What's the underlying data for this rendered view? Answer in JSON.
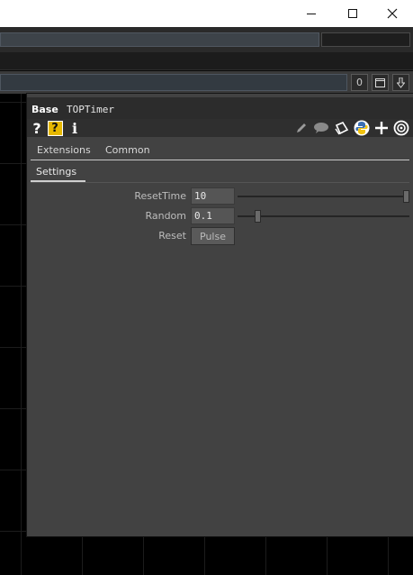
{
  "window": {
    "controls": {
      "minimize": "minimize-icon",
      "maximize": "maximize-icon",
      "close": "close-icon"
    }
  },
  "toolbar": {
    "counter_label": "0",
    "layout_icon": "window-icon",
    "pin_icon": "down-arrow-icon"
  },
  "panel": {
    "type_label": "Base",
    "name_label": "TOPTimer",
    "icons": [
      "help-icon",
      "python-help-icon",
      "info-icon",
      "edit-icon",
      "comment-icon",
      "clone-icon",
      "python-icon",
      "add-icon",
      "viewer-icon"
    ],
    "page_tabs": [
      "Extensions",
      "Common"
    ],
    "active_page": "Settings",
    "params": [
      {
        "label": "ResetTime",
        "value": "10",
        "slider_fraction": 1.0
      },
      {
        "label": "Random",
        "value": "0.1",
        "slider_fraction": 0.12
      },
      {
        "label": "Reset",
        "button": "Pulse"
      }
    ]
  }
}
